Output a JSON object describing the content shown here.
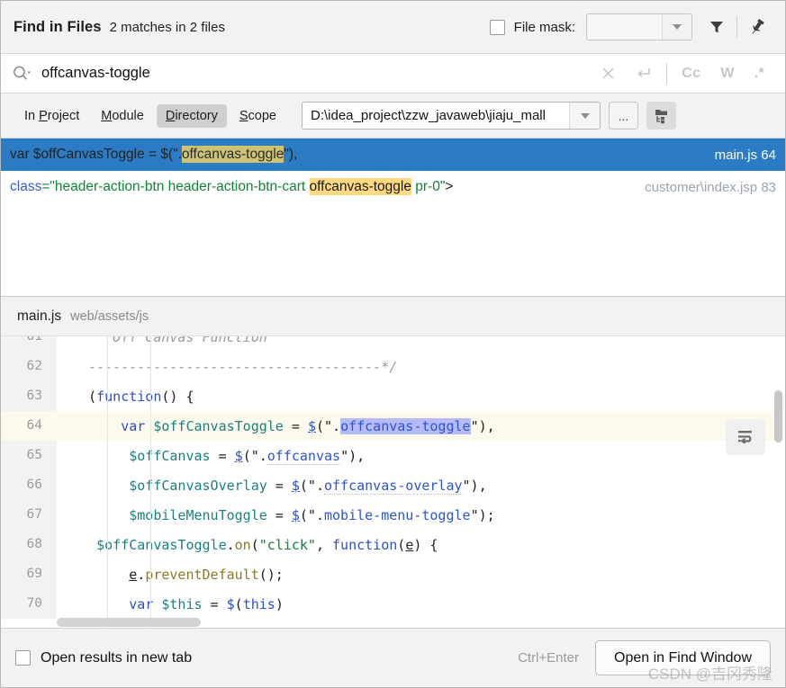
{
  "window": {
    "title": "Find in Files",
    "match_summary": "2 matches in 2 files"
  },
  "header": {
    "file_mask_label": "File mask:",
    "file_mask_value": "",
    "filter_icon": "filter-funnel-icon",
    "pin_icon": "pin-icon"
  },
  "search": {
    "query": "offcanvas-toggle",
    "placeholder": "",
    "search_icon": "search-icon",
    "clear_icon": "close-icon",
    "newline_icon": "new-line-icon",
    "match_case_label": "Cc",
    "words_label": "W",
    "regex_label": ".*"
  },
  "scope": {
    "tabs": [
      {
        "label": "In Project",
        "mnemonic": "P",
        "active": false
      },
      {
        "label": "Module",
        "mnemonic": "M",
        "active": false
      },
      {
        "label": "Directory",
        "mnemonic": "D",
        "active": true
      },
      {
        "label": "Scope",
        "mnemonic": "S",
        "active": false
      }
    ],
    "path_value": "D:\\idea_project\\zzw_javaweb\\jiaju_mall",
    "browse_label": "...",
    "tree_icon": "folder-tree-icon"
  },
  "results": [
    {
      "selected": true,
      "location": "main.js 64",
      "parts": [
        {
          "text": "var $offCanvasToggle = $(\".",
          "style": "plain"
        },
        {
          "text": "offcanvas-toggle",
          "style": "highlight-olive"
        },
        {
          "text": "\"),",
          "style": "plain"
        }
      ]
    },
    {
      "selected": false,
      "location": "customer\\index.jsp 83",
      "parts": [
        {
          "text": "class",
          "style": "attr"
        },
        {
          "text": "=\"header-action-btn header-action-btn-cart ",
          "style": "string"
        },
        {
          "text": "offcanvas-toggle",
          "style": "highlight-yellow"
        },
        {
          "text": " pr-0\"",
          "style": "string"
        },
        {
          "text": ">",
          "style": "plain"
        }
      ]
    }
  ],
  "preview": {
    "file_name": "main.js",
    "file_path": "web/assets/js",
    "wrap_icon": "soft-wrap-icon",
    "lines": [
      {
        "number": "61",
        "highlight": false,
        "tokens": [
          {
            "text": "      Off Canvas Function",
            "cls": "c-comment"
          }
        ]
      },
      {
        "number": "62",
        "highlight": false,
        "tokens": [
          {
            "text": "   ------------------------------------*/",
            "cls": "c-comment"
          }
        ]
      },
      {
        "number": "63",
        "highlight": false,
        "tokens": [
          {
            "text": "   (",
            "cls": "c-plain"
          },
          {
            "text": "function",
            "cls": "c-kw"
          },
          {
            "text": "() {",
            "cls": "c-plain"
          }
        ]
      },
      {
        "number": "64",
        "highlight": true,
        "tokens": [
          {
            "text": "       ",
            "cls": "c-plain"
          },
          {
            "text": "var",
            "cls": "c-kw"
          },
          {
            "text": " ",
            "cls": "c-plain"
          },
          {
            "text": "$offCanvasToggle",
            "cls": "c-var"
          },
          {
            "text": " = ",
            "cls": "c-plain"
          },
          {
            "text": "$",
            "cls": "c-kw u-line"
          },
          {
            "text": "(\".",
            "cls": "c-plain"
          },
          {
            "text": "offcanvas-toggle",
            "cls": "c-str c-match"
          },
          {
            "text": "\"),",
            "cls": "c-plain"
          }
        ]
      },
      {
        "number": "65",
        "highlight": false,
        "tokens": [
          {
            "text": "        ",
            "cls": "c-plain"
          },
          {
            "text": "$offCanvas",
            "cls": "c-var"
          },
          {
            "text": " = ",
            "cls": "c-plain"
          },
          {
            "text": "$",
            "cls": "c-kw u-line"
          },
          {
            "text": "(\".",
            "cls": "c-plain"
          },
          {
            "text": "offcanvas",
            "cls": "c-str u-wave"
          },
          {
            "text": "\"),",
            "cls": "c-plain"
          }
        ]
      },
      {
        "number": "66",
        "highlight": false,
        "tokens": [
          {
            "text": "        ",
            "cls": "c-plain"
          },
          {
            "text": "$offCanvasOverlay",
            "cls": "c-var"
          },
          {
            "text": " = ",
            "cls": "c-plain"
          },
          {
            "text": "$",
            "cls": "c-kw u-line"
          },
          {
            "text": "(\".",
            "cls": "c-plain"
          },
          {
            "text": "offcanvas-overlay",
            "cls": "c-str u-wave"
          },
          {
            "text": "\"),",
            "cls": "c-plain"
          }
        ]
      },
      {
        "number": "67",
        "highlight": false,
        "tokens": [
          {
            "text": "        ",
            "cls": "c-plain"
          },
          {
            "text": "$mobileMenuToggle",
            "cls": "c-var"
          },
          {
            "text": " = ",
            "cls": "c-plain"
          },
          {
            "text": "$",
            "cls": "c-kw u-line"
          },
          {
            "text": "(\".",
            "cls": "c-plain"
          },
          {
            "text": "mobile-menu-toggle",
            "cls": "c-str"
          },
          {
            "text": "\");",
            "cls": "c-plain"
          }
        ]
      },
      {
        "number": "68",
        "highlight": false,
        "tokens": [
          {
            "text": "    ",
            "cls": "c-plain"
          },
          {
            "text": "$offCanvasToggle",
            "cls": "c-var"
          },
          {
            "text": ".",
            "cls": "c-plain"
          },
          {
            "text": "on",
            "cls": "c-fn"
          },
          {
            "text": "(",
            "cls": "c-plain"
          },
          {
            "text": "\"click\"",
            "cls": "c-strg"
          },
          {
            "text": ", ",
            "cls": "c-plain"
          },
          {
            "text": "function",
            "cls": "c-kw"
          },
          {
            "text": "(",
            "cls": "c-plain"
          },
          {
            "text": "e",
            "cls": "c-plain u-line"
          },
          {
            "text": ") {",
            "cls": "c-plain"
          }
        ]
      },
      {
        "number": "69",
        "highlight": false,
        "tokens": [
          {
            "text": "        ",
            "cls": "c-plain"
          },
          {
            "text": "e",
            "cls": "c-plain u-line"
          },
          {
            "text": ".",
            "cls": "c-plain"
          },
          {
            "text": "preventDefault",
            "cls": "c-fn"
          },
          {
            "text": "();",
            "cls": "c-plain"
          }
        ]
      },
      {
        "number": "70",
        "highlight": false,
        "tokens": [
          {
            "text": "        ",
            "cls": "c-plain"
          },
          {
            "text": "var",
            "cls": "c-kw"
          },
          {
            "text": " ",
            "cls": "c-plain"
          },
          {
            "text": "$this",
            "cls": "c-var"
          },
          {
            "text": " = ",
            "cls": "c-plain"
          },
          {
            "text": "$",
            "cls": "c-kw"
          },
          {
            "text": "(",
            "cls": "c-plain"
          },
          {
            "text": "this",
            "cls": "c-kw"
          },
          {
            "text": ")",
            "cls": "c-plain"
          }
        ]
      }
    ]
  },
  "footer": {
    "open_new_tab_label": "Open results in new tab",
    "shortcut": "Ctrl+Enter",
    "primary_button": "Open in Find Window",
    "watermark": "CSDN @吉冈秀隆"
  }
}
